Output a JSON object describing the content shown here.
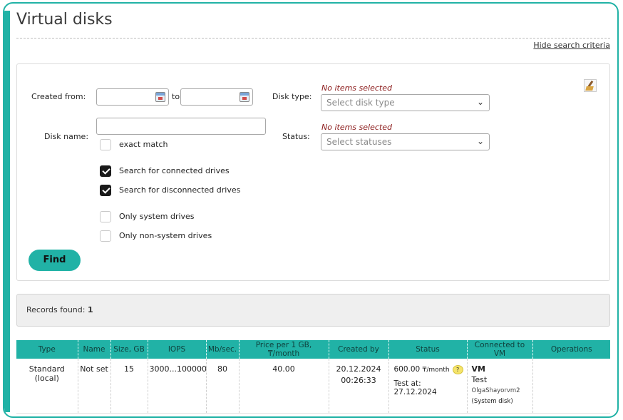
{
  "page": {
    "title": "Virtual disks",
    "hide_link": "Hide search criteria"
  },
  "colors": {
    "accent": "#21b2a6",
    "not_set": "#e02020",
    "no_items": "#8b1a1a"
  },
  "search": {
    "created_from_label": "Created from:",
    "to_label": "to",
    "disk_name_label": "Disk name:",
    "disk_type_label": "Disk type:",
    "status_label": "Status:",
    "disk_type_no_items": "No items selected",
    "disk_type_placeholder": "Select disk type",
    "status_no_items": "No items selected",
    "status_placeholder": "Select statuses",
    "checkboxes": {
      "exact_match": "exact match",
      "connected": "Search for connected drives",
      "disconnected": "Search for disconnected drives",
      "only_system": "Only system drives",
      "only_non_system": "Only non-system drives"
    },
    "find_label": "Find",
    "icons": {
      "calendar": "calendar-icon",
      "clear": "broom-icon",
      "dropdown": "chevron-down-icon"
    }
  },
  "records": {
    "label": "Records found:",
    "count": "1"
  },
  "table": {
    "headers": [
      "Type",
      "Name",
      "Size, GB",
      "IOPS",
      "Mb/sec.",
      "Price per 1 GB, ₸/month",
      "Created by",
      "Status",
      "Connected to VM",
      "Operations"
    ],
    "rows": [
      {
        "type": "Standard (local)",
        "name": "Not set",
        "size": "15",
        "iops": "3000...100000",
        "mbps": "80",
        "price": "40.00",
        "created_date": "20.12.2024",
        "created_time": "00:26:33",
        "status_price": "600.00",
        "status_unit": "₸/month",
        "status_help": "?",
        "status_test": "Test at: 27.12.2024",
        "vm_name": "VM",
        "vm_label": "Test",
        "vm_user": "OlgaShayorvm2",
        "vm_system": "(System disk)",
        "operations": ""
      }
    ]
  }
}
